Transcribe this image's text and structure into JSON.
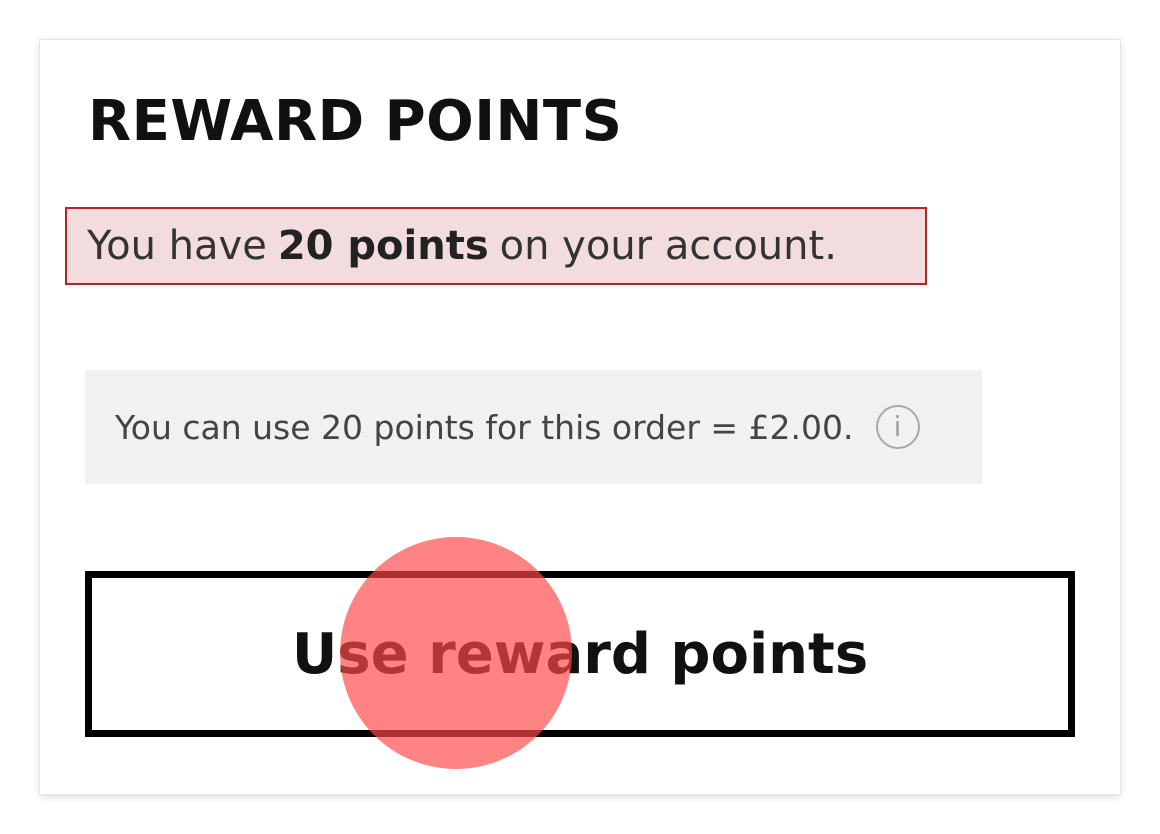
{
  "reward_points": {
    "title": "REWARD POINTS",
    "balance": {
      "prefix": "You have",
      "points": "20 points",
      "suffix": "on your account."
    },
    "info": {
      "text": "You can use 20 points for this order = £2.00.",
      "icon_glyph": "i"
    },
    "use_button_label": "Use reward points"
  },
  "colors": {
    "highlight_border": "#b5232a",
    "highlight_fill": "#f3dcdd",
    "tap_marker": "#ff4848"
  }
}
